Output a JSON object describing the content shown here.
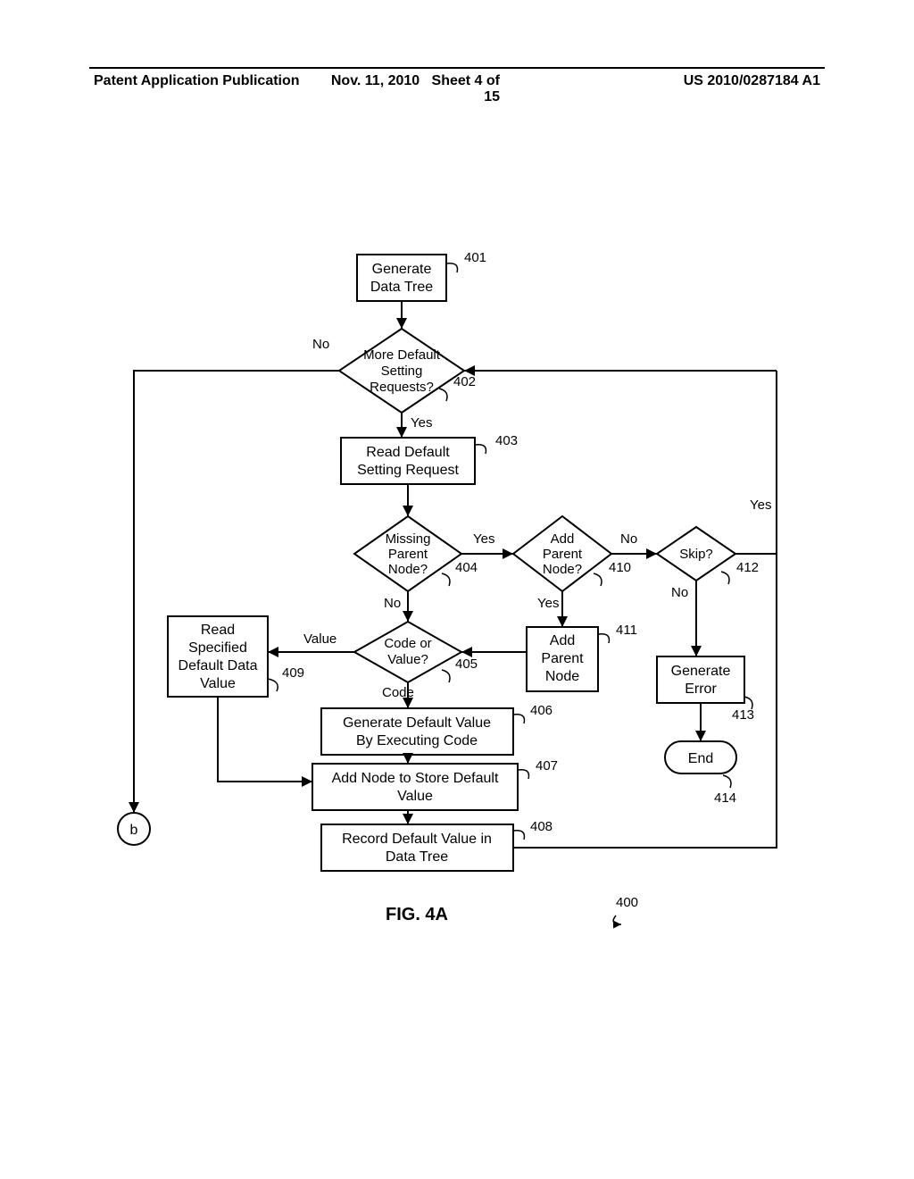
{
  "header": {
    "left": "Patent Application Publication",
    "date": "Nov. 11, 2010",
    "sheet": "Sheet 4 of 15",
    "pubno": "US 2010/0287184 A1"
  },
  "figure": {
    "caption": "FIG. 4A",
    "overall_ref": "400",
    "connector_b": "b",
    "labels": {
      "yes": "Yes",
      "no": "No",
      "value": "Value",
      "code": "Code"
    },
    "nodes": {
      "n401": {
        "ref": "401",
        "text_l1": "Generate",
        "text_l2": "Data Tree"
      },
      "n402": {
        "ref": "402",
        "text_l1": "More Default",
        "text_l2": "Setting",
        "text_l3": "Requests?"
      },
      "n403": {
        "ref": "403",
        "text_l1": "Read Default",
        "text_l2": "Setting Request"
      },
      "n404": {
        "ref": "404",
        "text_l1": "Missing",
        "text_l2": "Parent",
        "text_l3": "Node?"
      },
      "n405": {
        "ref": "405",
        "text_l1": "Code or",
        "text_l2": "Value?"
      },
      "n406": {
        "ref": "406",
        "text_l1": "Generate Default Value",
        "text_l2": "By Executing Code"
      },
      "n407": {
        "ref": "407",
        "text_l1": "Add Node to Store Default",
        "text_l2": "Value"
      },
      "n408": {
        "ref": "408",
        "text_l1": "Record Default Value in",
        "text_l2": "Data Tree"
      },
      "n409": {
        "ref": "409",
        "text_l1": "Read",
        "text_l2": "Specified",
        "text_l3": "Default Data",
        "text_l4": "Value"
      },
      "n410": {
        "ref": "410",
        "text_l1": "Add",
        "text_l2": "Parent",
        "text_l3": "Node?"
      },
      "n411": {
        "ref": "411",
        "text_l1": "Add",
        "text_l2": "Parent",
        "text_l3": "Node"
      },
      "n412": {
        "ref": "412",
        "text_l1": "Skip?"
      },
      "n413": {
        "ref": "413",
        "text_l1": "Generate",
        "text_l2": "Error"
      },
      "n414": {
        "ref": "414",
        "text_l1": "End"
      }
    }
  }
}
